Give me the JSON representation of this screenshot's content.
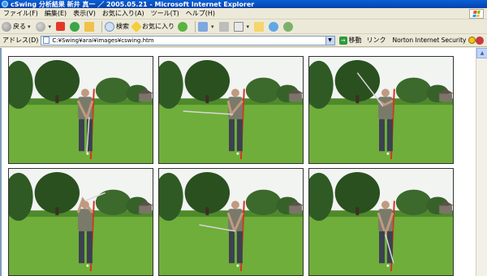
{
  "window": {
    "title": "cSwing 分析結果 新井 真一 ／ 2005.05.21 - Microsoft Internet Explorer"
  },
  "menu": [
    "ファイル(F)",
    "編集(E)",
    "表示(V)",
    "お気に入り(A)",
    "ツール(T)",
    "ヘルプ(H)"
  ],
  "toolbar": {
    "back_label": "戻る",
    "search_label": "検索",
    "favorites_label": "お気に入り"
  },
  "address": {
    "label": "アドレス(D)",
    "url": "C:¥Swing¥arai¥images¥cswing.htm",
    "go_label": "移動",
    "links_label": "リンク",
    "norton_label": "Norton Internet Security"
  },
  "frames": [
    {
      "name": "swing-frame-1",
      "phase": "address"
    },
    {
      "name": "swing-frame-2",
      "phase": "takeaway"
    },
    {
      "name": "swing-frame-3",
      "phase": "top"
    },
    {
      "name": "swing-frame-4",
      "phase": "backswing"
    },
    {
      "name": "swing-frame-5",
      "phase": "downswing"
    },
    {
      "name": "swing-frame-6",
      "phase": "impact"
    }
  ],
  "colors": {
    "sky": "#f2f4f2",
    "grass": "#6fae3a",
    "trees": "#2f5a24",
    "guide_line": "#d6341c",
    "shirt": "#7a7a6a",
    "pants": "#3c4150"
  }
}
